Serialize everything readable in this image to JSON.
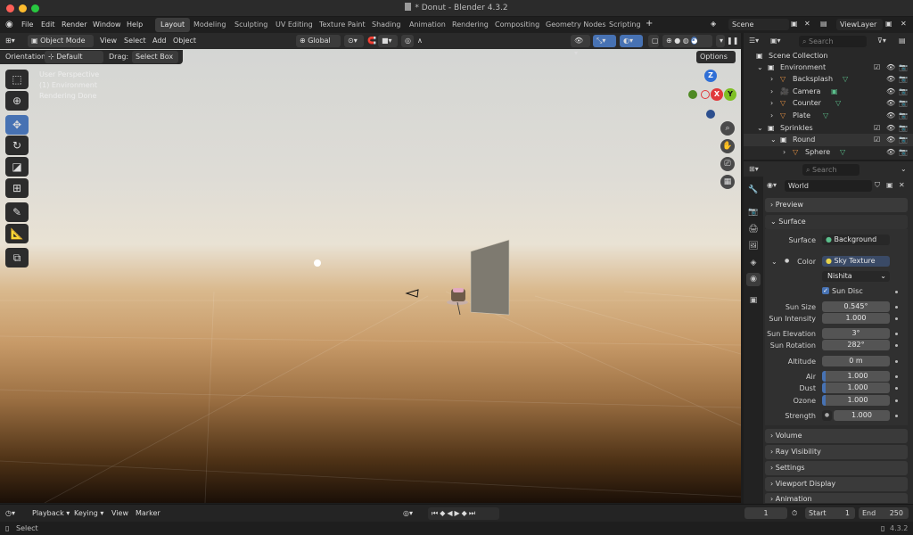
{
  "window": {
    "title": "* Donut - Blender 4.3.2"
  },
  "menu": [
    "File",
    "Edit",
    "Render",
    "Window",
    "Help"
  ],
  "workspaces": [
    "Layout",
    "Modeling",
    "Sculpting",
    "UV Editing",
    "Texture Paint",
    "Shading",
    "Animation",
    "Rendering",
    "Compositing",
    "Geometry Nodes",
    "Scripting"
  ],
  "workspace_active": "Layout",
  "scene": {
    "name": "Scene",
    "view_layer": "ViewLayer"
  },
  "viewport": {
    "mode": "Object Mode",
    "menus": [
      "View",
      "Select",
      "Add",
      "Object"
    ],
    "transform": "Global",
    "orientation_label": "Orientation:",
    "orientation_value": "Default",
    "drag_label": "Drag:",
    "drag_value": "Select Box",
    "options": "Options",
    "overlay_lines": [
      "User Perspective",
      "(1) Environment",
      "Rendering Done"
    ],
    "gizmo": {
      "z": "Z",
      "x": "X",
      "y": "Y"
    }
  },
  "outliner": {
    "search_placeholder": "Search",
    "root": "Scene Collection",
    "items": [
      {
        "label": "Environment",
        "kind": "collection"
      },
      {
        "label": "Backsplash",
        "kind": "object"
      },
      {
        "label": "Camera",
        "kind": "camera"
      },
      {
        "label": "Counter",
        "kind": "object"
      },
      {
        "label": "Plate",
        "kind": "object"
      },
      {
        "label": "Sprinkles",
        "kind": "collection"
      },
      {
        "label": "Round",
        "kind": "collection"
      },
      {
        "label": "Sphere",
        "kind": "object"
      }
    ]
  },
  "properties": {
    "search_placeholder": "Search",
    "world_name": "World",
    "panels": {
      "preview": "Preview",
      "surface": "Surface",
      "volume": "Volume",
      "ray_visibility": "Ray Visibility",
      "settings": "Settings",
      "viewport_display": "Viewport Display",
      "animation": "Animation"
    },
    "surface_label": "Surface",
    "surface_value": "Background",
    "color_label": "Color",
    "color_value": "Sky Texture",
    "sky_type": "Nishita",
    "sun_disc": "Sun Disc",
    "fields": [
      {
        "label": "Sun Size",
        "value": "0.545°"
      },
      {
        "label": "Sun Intensity",
        "value": "1.000"
      },
      {
        "label": "Sun Elevation",
        "value": "3°"
      },
      {
        "label": "Sun Rotation",
        "value": "282°"
      },
      {
        "label": "Altitude",
        "value": "0 m"
      },
      {
        "label": "Air",
        "value": "1.000"
      },
      {
        "label": "Dust",
        "value": "1.000"
      },
      {
        "label": "Ozone",
        "value": "1.000"
      },
      {
        "label": "Strength",
        "value": "1.000"
      }
    ]
  },
  "timeline": {
    "menus": [
      "Playback",
      "Keying",
      "View",
      "Marker"
    ],
    "current_frame": "1",
    "start_label": "Start",
    "start": "1",
    "end_label": "End",
    "end": "250"
  },
  "status": {
    "left": "Select",
    "version": "4.3.2"
  },
  "colors": {
    "accent": "#4772b3",
    "collection_white": "#e6e6e6",
    "object_orange": "#e69244",
    "mesh_green": "#5bbf8c"
  }
}
